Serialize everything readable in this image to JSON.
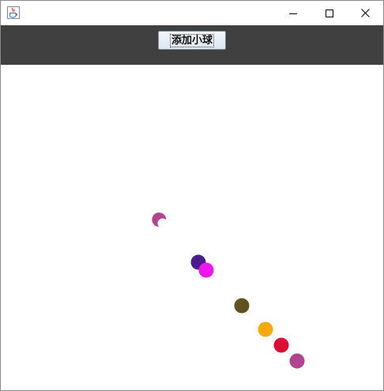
{
  "window": {
    "controls": {
      "minimize_icon": "minimize-icon",
      "maximize_icon": "maximize-icon",
      "close_icon": "close-icon"
    },
    "app_icon": "java-coffee-cup-icon"
  },
  "toolbar": {
    "add_ball_label": "添加小球",
    "background": "#404040"
  },
  "canvas": {
    "background": "#ffffff",
    "balls": [
      {
        "color": "#b0448f",
        "partial": true
      },
      {
        "color": "#4a1c8c"
      },
      {
        "color": "#ee16ee"
      },
      {
        "color": "#5f5220"
      },
      {
        "color": "#f7a80c"
      },
      {
        "color": "#dd0d33"
      },
      {
        "color": "#b0448f"
      }
    ]
  }
}
